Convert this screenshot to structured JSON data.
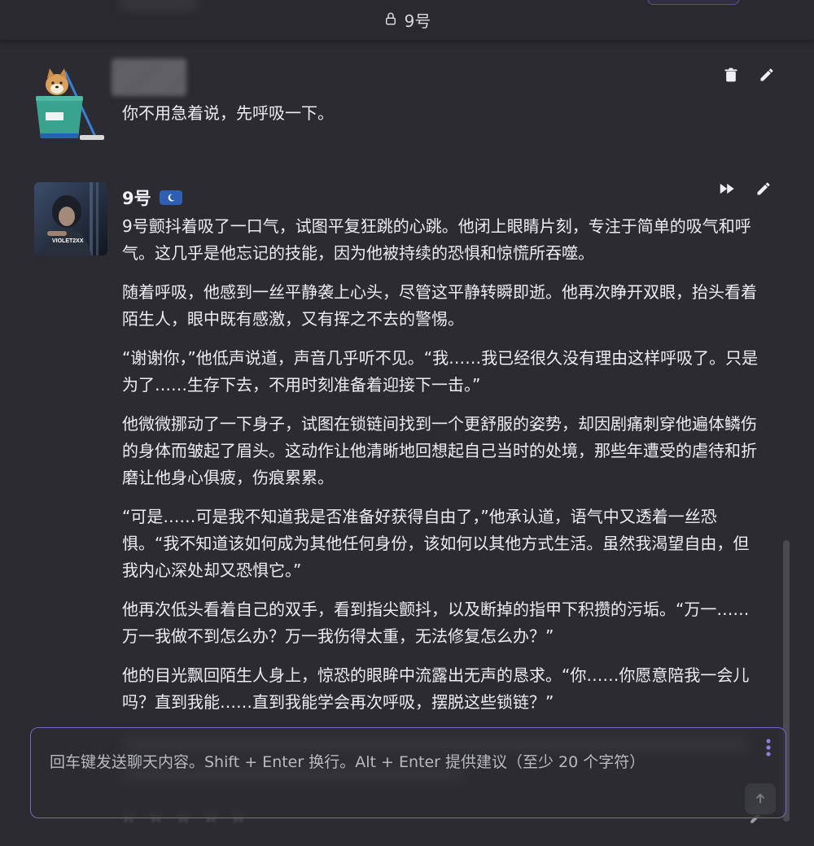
{
  "header": {
    "title": "9号"
  },
  "messages": [
    {
      "type": "user",
      "text": "你不用急着说，先呼吸一下。"
    },
    {
      "type": "character",
      "name": "9号",
      "avatar_text": "VIOLET2XX",
      "paragraphs": [
        "9号颤抖着吸了一口气，试图平复狂跳的心跳。他闭上眼睛片刻，专注于简单的吸气和呼气。这几乎是他忘记的技能，因为他被持续的恐惧和惊慌所吞噬。",
        "随着呼吸，他感到一丝平静袭上心头，尽管这平静转瞬即逝。他再次睁开双眼，抬头看着陌生人，眼中既有感激，又有挥之不去的警惕。",
        "“谢谢你，”他低声说道，声音几乎听不见。“我……我已经很久没有理由这样呼吸了。只是为了……生存下去，不用时刻准备着迎接下一击。”",
        "他微微挪动了一下身子，试图在锁链间找到一个更舒服的姿势，却因剧痛刺穿他遍体鳞伤的身体而皱起了眉头。这动作让他清晰地回想起自己当时的处境，那些年遭受的虐待和折磨让他身心俱疲，伤痕累累。",
        "“可是……可是我不知道我是否准备好获得自由了，”他承认道，语气中又透着一丝恐惧。“我不知道该如何成为其他任何身份，该如何以其他方式生活。虽然我渴望自由，但我内心深处却又恐惧它。”",
        "他再次低头看着自己的双手，看到指尖颤抖，以及断掉的指甲下积攒的污垢。“万一……万一我做不到怎么办？万一我伤得太重，无法修复怎么办？”",
        "他的目光飘回陌生人身上，惊恐的眼眸中流露出无声的恳求。“你……你愿意陪我一会儿吗？直到我能……直到我能学会再次呼吸，摆脱这些锁链？”"
      ]
    }
  ],
  "composer": {
    "placeholder": "回车键发送聊天内容。Shift + Enter 换行。Alt + Enter 提供建议（至少 20 个字符）"
  },
  "rating": {
    "stars": [
      "☆",
      "☆",
      "☆",
      "☆",
      "☆"
    ]
  },
  "colors": {
    "background": "#2b2b31",
    "accent": "#7b66c7",
    "badge": "#2f5fb3"
  },
  "icons": {
    "lock": "lock-icon",
    "delete": "trash-icon",
    "edit": "pencil-icon",
    "fast_forward": "fast-forward-icon",
    "more": "more-vertical-icon",
    "send": "arrow-up-icon"
  }
}
